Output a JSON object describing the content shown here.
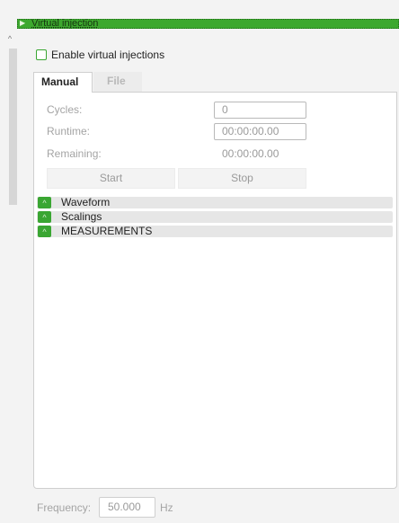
{
  "header": {
    "title": "Virtual injection",
    "arrow_icon": "chevron-right-icon"
  },
  "scrollbar": {
    "up_glyph": "^"
  },
  "enable": {
    "label": "Enable virtual injections",
    "checked": false
  },
  "tabs": [
    {
      "label": "Manual",
      "active": true
    },
    {
      "label": "File",
      "active": false
    }
  ],
  "manual": {
    "cycles": {
      "label": "Cycles:",
      "value": "0"
    },
    "runtime": {
      "label": "Runtime:",
      "value": "00:00:00.00"
    },
    "remaining": {
      "label": "Remaining:",
      "value": "00:00:00.00"
    },
    "start_label": "Start",
    "stop_label": "Stop"
  },
  "sections": [
    {
      "label": "Waveform",
      "icon": "chevron-up-icon",
      "glyph": "^"
    },
    {
      "label": "Scalings",
      "icon": "chevron-up-icon",
      "glyph": "^"
    },
    {
      "label": "MEASUREMENTS",
      "icon": "chevron-up-icon",
      "glyph": "^"
    }
  ],
  "frequency": {
    "label": "Frequency:",
    "value": "50.000",
    "unit": "Hz"
  },
  "colors": {
    "accent": "#3aa632",
    "header_bg": "#3da82f"
  }
}
